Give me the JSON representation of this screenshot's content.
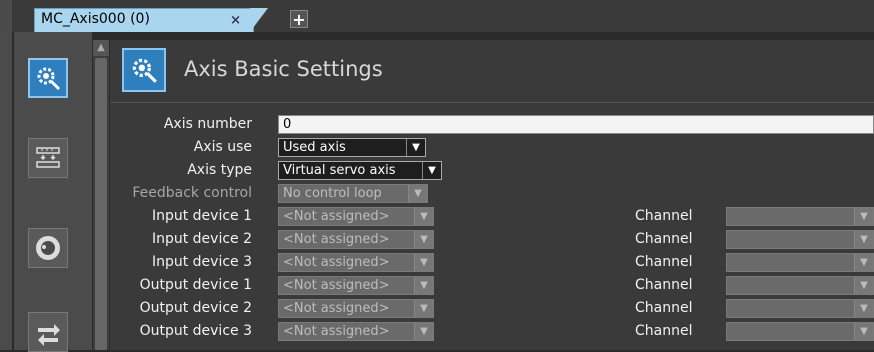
{
  "tabs": [
    {
      "label": "MC_Axis000 (0)",
      "close": "×"
    }
  ],
  "add_tab": "+",
  "sidebar": {
    "items": [
      {
        "icon": "axis-settings-icon",
        "active": true
      },
      {
        "icon": "unit-conversion-icon",
        "active": false
      },
      {
        "icon": "operation-settings-icon",
        "active": false
      },
      {
        "icon": "transfer-icon",
        "active": false
      }
    ]
  },
  "header": {
    "title": "Axis Basic Settings",
    "icon": "axis-settings-icon"
  },
  "form": {
    "axis_number": {
      "label": "Axis number",
      "value": "0"
    },
    "axis_use": {
      "label": "Axis use",
      "value": "Used axis"
    },
    "axis_type": {
      "label": "Axis type",
      "value": "Virtual servo axis"
    },
    "feedback_control": {
      "label": "Feedback control",
      "value": "No control loop"
    },
    "channel_label": "Channel",
    "devices": [
      {
        "label": "Input device 1",
        "value": "<Not assigned>"
      },
      {
        "label": "Input device 2",
        "value": "<Not assigned>"
      },
      {
        "label": "Input device 3",
        "value": "<Not assigned>"
      },
      {
        "label": "Output device 1",
        "value": "<Not assigned>"
      },
      {
        "label": "Output device 2",
        "value": "<Not assigned>"
      },
      {
        "label": "Output device 3",
        "value": "<Not assigned>"
      }
    ]
  },
  "colors": {
    "accent": "#2f7fbf",
    "tab": "#a9d6ee",
    "background": "#3a3a3a"
  }
}
